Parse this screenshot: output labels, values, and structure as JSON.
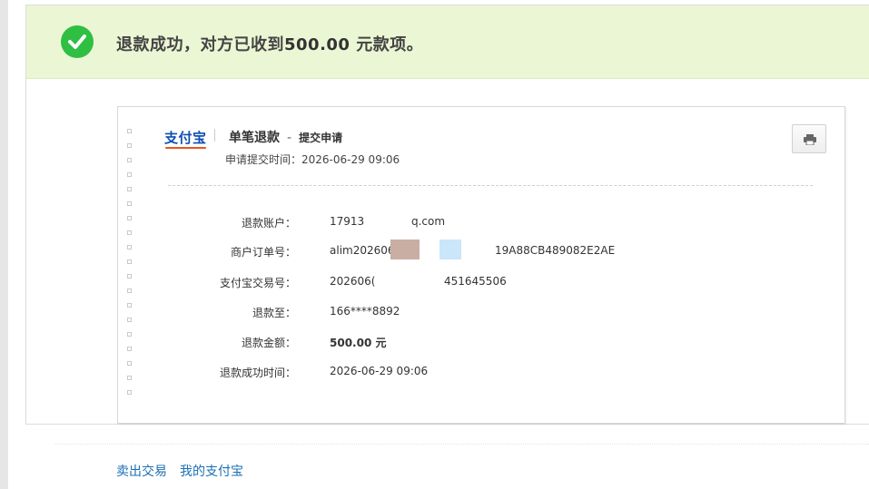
{
  "banner": {
    "message_prefix": "退款成功，对方已收到",
    "amount": "500.00",
    "message_suffix": " 元款项。"
  },
  "receipt": {
    "logo_text": "支付宝",
    "title": "单笔退款",
    "dash": "-",
    "subtitle": "提交申请",
    "applied_time": "申请提交时间：2026-06-29 09:06",
    "print_icon": "printer-icon",
    "rows": [
      {
        "label": "退款账户：",
        "value": "17913",
        "value_tail": "q.com"
      },
      {
        "label": "商户订单号：",
        "value": "alim202606",
        "value_tail": "19A88CB489082E2AE"
      },
      {
        "label": "支付宝交易号：",
        "value": "202606(",
        "value_tail": "451645506"
      },
      {
        "label": "退款至：",
        "value": "166****8892"
      },
      {
        "label": "退款金额：",
        "value": "500.00 元"
      },
      {
        "label": "退款成功时间：",
        "value": "2026-06-29 09:06"
      }
    ]
  },
  "footer": {
    "link_sell": "卖出交易",
    "link_my_alipay": "我的支付宝"
  },
  "colors": {
    "banner_bg": "#ebf7d4",
    "success_green": "#2fbf43",
    "link_blue": "#1b6fb3",
    "logo_blue": "#0f4fb1",
    "logo_orange": "#e8561b"
  }
}
